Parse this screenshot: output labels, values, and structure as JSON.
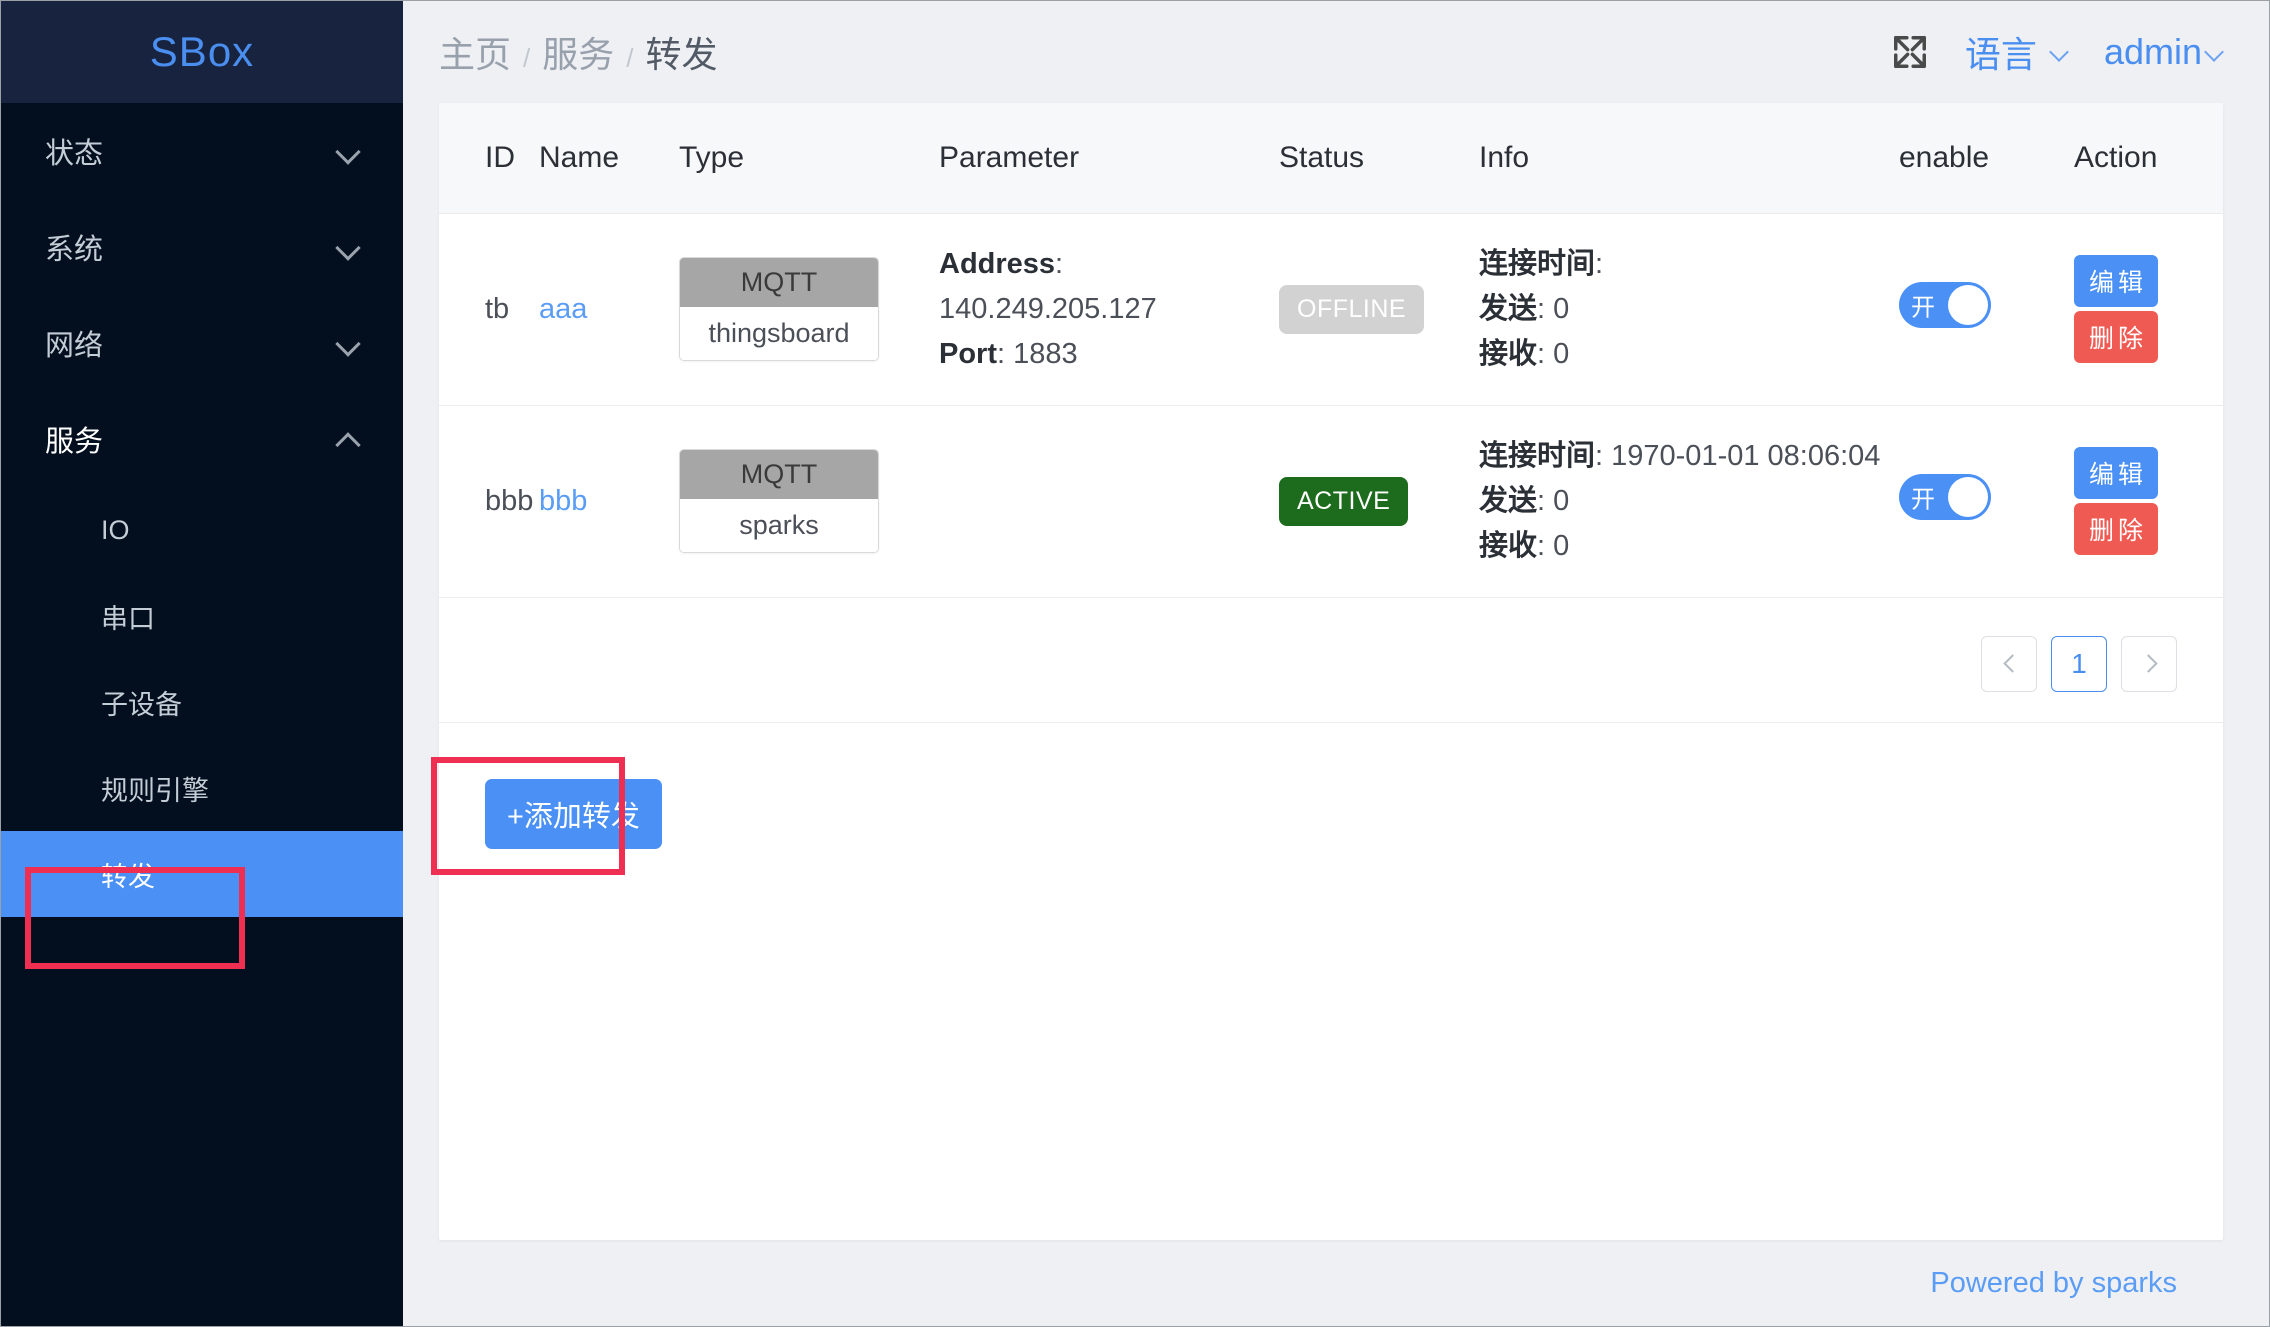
{
  "sidebar": {
    "logo": "SBox",
    "groups": [
      {
        "label": "状态",
        "expanded": false
      },
      {
        "label": "系统",
        "expanded": false
      },
      {
        "label": "网络",
        "expanded": false
      },
      {
        "label": "服务",
        "expanded": true
      }
    ],
    "submenu": [
      {
        "label": "IO",
        "active": false
      },
      {
        "label": "串口",
        "active": false
      },
      {
        "label": "子设备",
        "active": false
      },
      {
        "label": "规则引擎",
        "active": false
      },
      {
        "label": "转发",
        "active": true
      }
    ]
  },
  "topbar": {
    "breadcrumb": [
      "主页",
      "服务",
      "转发"
    ],
    "separator": "/",
    "fullscreen_icon": "fullscreen-expand-icon",
    "language_label": "语言",
    "user_label": "admin"
  },
  "table": {
    "columns": [
      "ID",
      "Name",
      "Type",
      "Parameter",
      "Status",
      "Info",
      "enable",
      "Action"
    ],
    "rows": [
      {
        "id": "tb",
        "name": "aaa",
        "type_protocol": "MQTT",
        "type_platform": "thingsboard",
        "param_address_label": "Address",
        "param_address_value": "140.249.205.127",
        "param_port_label": "Port",
        "param_port_value": "1883",
        "status": "OFFLINE",
        "status_kind": "offline",
        "info_conn_label": "连接时间",
        "info_conn_value": "",
        "info_send_label": "发送",
        "info_send_value": "0",
        "info_recv_label": "接收",
        "info_recv_value": "0",
        "enable_on": true,
        "enable_label": "开",
        "edit_label": "编辑",
        "delete_label": "删除"
      },
      {
        "id": "bbb",
        "name": "bbb",
        "type_protocol": "MQTT",
        "type_platform": "sparks",
        "param_address_label": "",
        "param_address_value": "",
        "param_port_label": "",
        "param_port_value": "",
        "status": "ACTIVE",
        "status_kind": "active",
        "info_conn_label": "连接时间",
        "info_conn_value": "1970-01-01 08:06:04",
        "info_send_label": "发送",
        "info_send_value": "0",
        "info_recv_label": "接收",
        "info_recv_value": "0",
        "enable_on": true,
        "enable_label": "开",
        "edit_label": "编辑",
        "delete_label": "删除"
      }
    ]
  },
  "pagination": {
    "prev_icon": "chevron-left-icon",
    "next_icon": "chevron-right-icon",
    "pages": [
      "1"
    ],
    "current": "1"
  },
  "actions": {
    "add_label": "+添加转发"
  },
  "footer": {
    "powered_by": "Powered by sparks"
  },
  "colors": {
    "accent": "#4a90f5",
    "sidebar_bg": "#030f1e",
    "logo_bg": "#18243f",
    "danger": "#ef5b53",
    "active_badge": "#1d6b1d",
    "offline_badge": "#d2d2d2",
    "highlight_box": "#ef2f52"
  }
}
